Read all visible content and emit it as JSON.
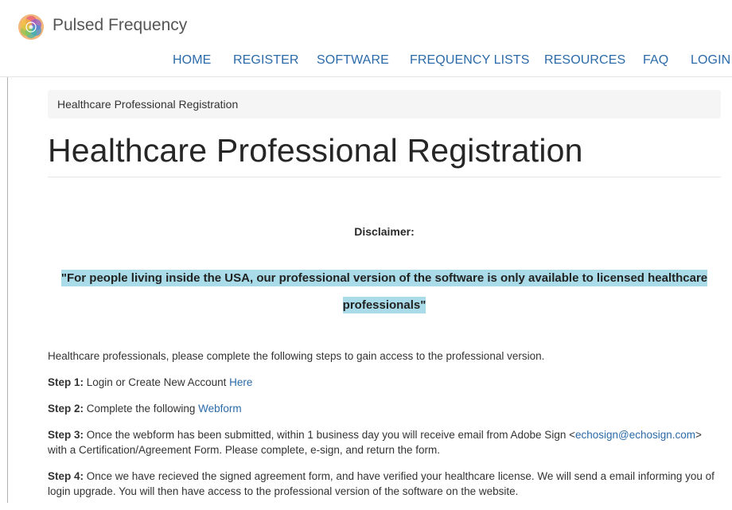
{
  "site": {
    "title": "Pulsed Frequency",
    "logo_icon": "flower-of-life-icon"
  },
  "nav": {
    "items": [
      "HOME",
      "REGISTER",
      "SOFTWARE",
      "FREQUENCY LISTS",
      "RESOURCES",
      "FAQ",
      "LOGIN"
    ]
  },
  "breadcrumb": {
    "current": "Healthcare Professional Registration"
  },
  "page": {
    "title": "Healthcare Professional Registration",
    "disclaimer_heading": "Disclaimer:",
    "disclaimer_quote": "\"For people living inside the USA, our professional version of the software is only available to licensed healthcare professionals\"",
    "intro": "Healthcare professionals, please complete the following steps to gain access to the professional version.",
    "steps": [
      {
        "label": "Step 1:",
        "text": " Login or Create New Account ",
        "link": "Here",
        "after": ""
      },
      {
        "label": "Step 2:",
        "text": " Complete the following ",
        "link": "Webform",
        "after": ""
      },
      {
        "label": "Step 3:",
        "text": " Once the webform has been submitted, within 1 business day you will receive email from Adobe Sign <",
        "link": "echosign@echosign.com",
        "after": "> with a Certification/Agreement Form. Please complete, e-sign, and return the form."
      },
      {
        "label": "Step 4:",
        "text": " Once we have recieved the signed agreement form, and have verified your healthcare license. We will send a email informing you of login upgrade. You will then have access to the professional version of the software on the website.",
        "link": "",
        "after": ""
      }
    ]
  },
  "colors": {
    "link": "#2b6aa8",
    "highlight": "#a9dbe8",
    "breadcrumb_bg": "#f5f5f5"
  }
}
